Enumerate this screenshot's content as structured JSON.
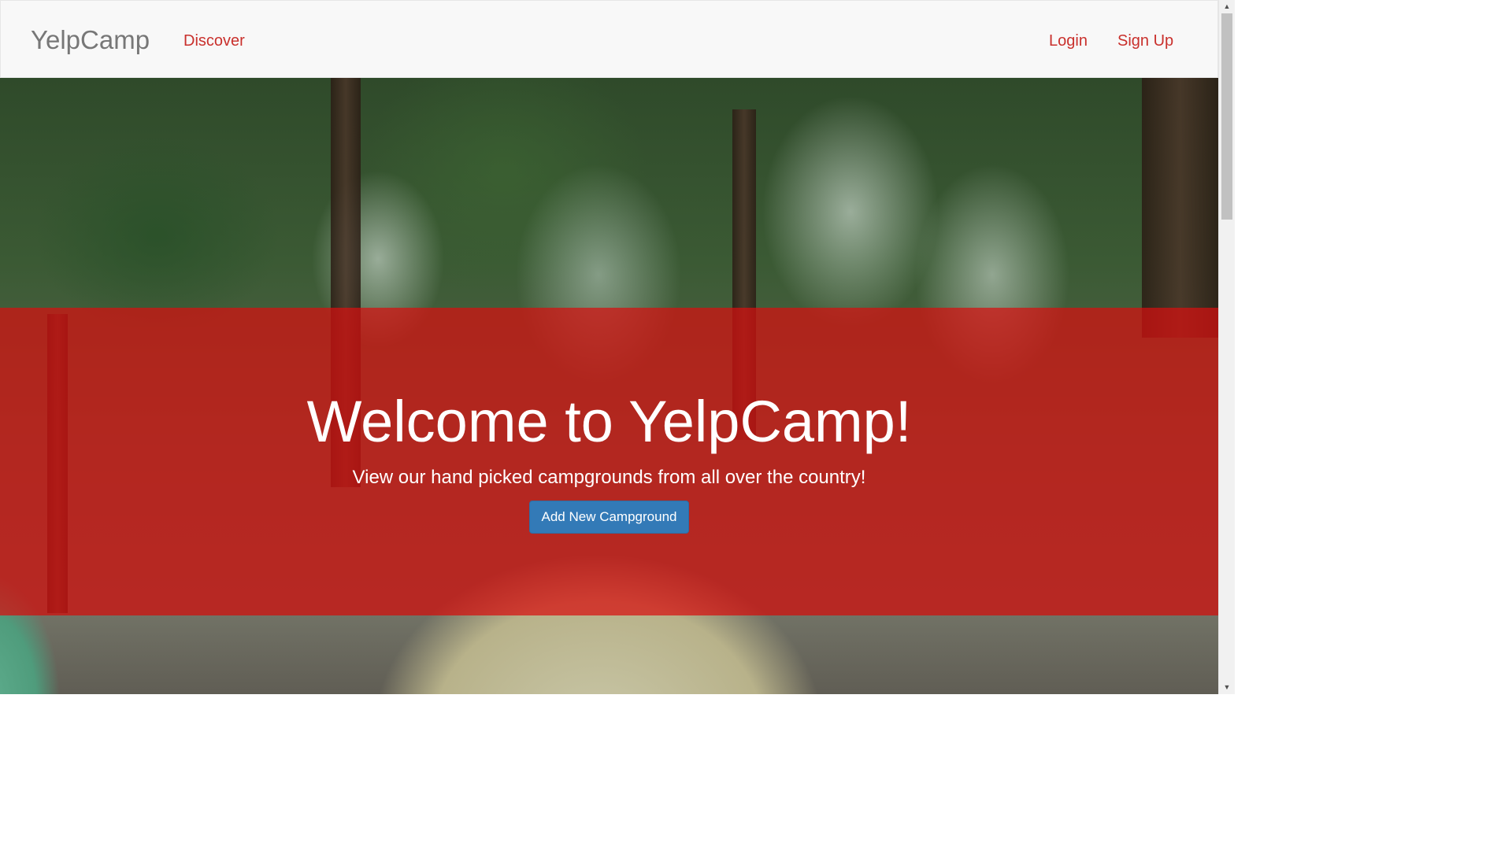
{
  "navbar": {
    "brand": "YelpCamp",
    "discover": "Discover",
    "login": "Login",
    "signup": "Sign Up"
  },
  "hero": {
    "title": "Welcome to YelpCamp!",
    "subtitle": "View our hand picked campgrounds from all over the country!",
    "button_label": "Add New Campground"
  },
  "colors": {
    "nav_link": "#c9302c",
    "overlay": "#d70f0f",
    "button": "#337ab7"
  },
  "icons": {
    "scroll_up": "triangle-up",
    "scroll_down": "triangle-down"
  }
}
